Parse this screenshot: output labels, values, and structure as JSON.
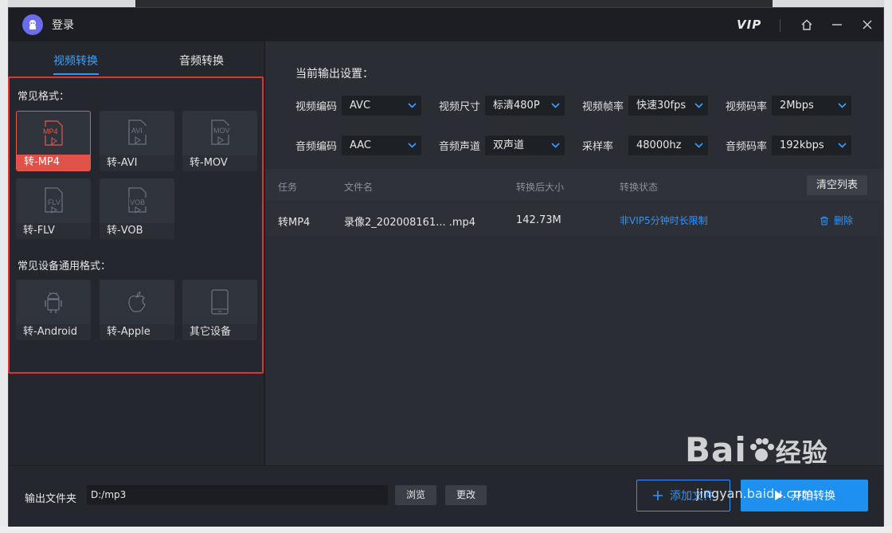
{
  "app": {
    "title": "登录",
    "vip_label": "VIP"
  },
  "tabs": [
    {
      "label": "视频转换",
      "active": true
    },
    {
      "label": "音频转换",
      "active": false
    }
  ],
  "common_formats": {
    "title": "常见格式：",
    "cards": [
      {
        "icon_text": "MP4",
        "label": "转-MP4",
        "active": true
      },
      {
        "icon_text": "AVI",
        "label": "转-AVI",
        "active": false
      },
      {
        "icon_text": "MOV",
        "label": "转-MOV",
        "active": false
      },
      {
        "icon_text": "FLV",
        "label": "转-FLV",
        "active": false
      },
      {
        "icon_text": "VOB",
        "label": "转-VOB",
        "active": false
      }
    ]
  },
  "device_formats": {
    "title": "常见设备通用格式：",
    "cards": [
      {
        "icon": "android-icon",
        "label": "转-Android"
      },
      {
        "icon": "apple-icon",
        "label": "转-Apple"
      },
      {
        "icon": "phone-icon",
        "label": "其它设备"
      }
    ]
  },
  "output_settings": {
    "title": "当前输出设置：",
    "video_codec": {
      "label": "视频编码",
      "value": "AVC"
    },
    "video_size": {
      "label": "视频尺寸",
      "value": "标清480P"
    },
    "video_fps": {
      "label": "视频帧率",
      "value": "快速30fps"
    },
    "video_bitrate": {
      "label": "视频码率",
      "value": "2Mbps"
    },
    "audio_codec": {
      "label": "音频编码",
      "value": "AAC"
    },
    "audio_channel": {
      "label": "音频声道",
      "value": "双声道"
    },
    "sample_rate": {
      "label": "采样率",
      "value": "48000hz"
    },
    "audio_bitrate": {
      "label": "音频码率",
      "value": "192kbps"
    }
  },
  "table": {
    "headers": [
      "任务",
      "文件名",
      "转换后大小",
      "转换状态"
    ],
    "clear_label": "清空列表",
    "rows": [
      {
        "task": "转MP4",
        "filename": "录像2_202008161... .mp4",
        "size": "142.73M",
        "status": "非VIP5分钟时长限制",
        "delete_label": "删除"
      }
    ]
  },
  "footer": {
    "output_label": "输出文件夹",
    "output_path": "D:/mp3",
    "browse_label": "浏览",
    "change_label": "更改",
    "add_label": "添加文件",
    "start_label": "开始转换"
  },
  "watermark": {
    "brand": "Bai",
    "suffix": "经验",
    "url": "jingyan.baidu.com"
  },
  "colors": {
    "accent": "#2f96ff",
    "active_card": "#e05149",
    "highlight_box": "#e53030"
  }
}
